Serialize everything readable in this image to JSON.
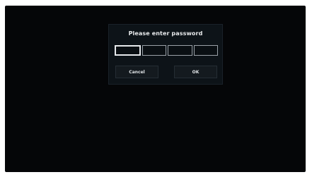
{
  "dialog": {
    "title": "Please enter password",
    "pin_boxes": 4,
    "cancel_label": "Cancel",
    "ok_label": "OK"
  },
  "colors": {
    "screen_background": "#050608",
    "dialog_background": "#0d1318",
    "text": "#e8eaec"
  }
}
